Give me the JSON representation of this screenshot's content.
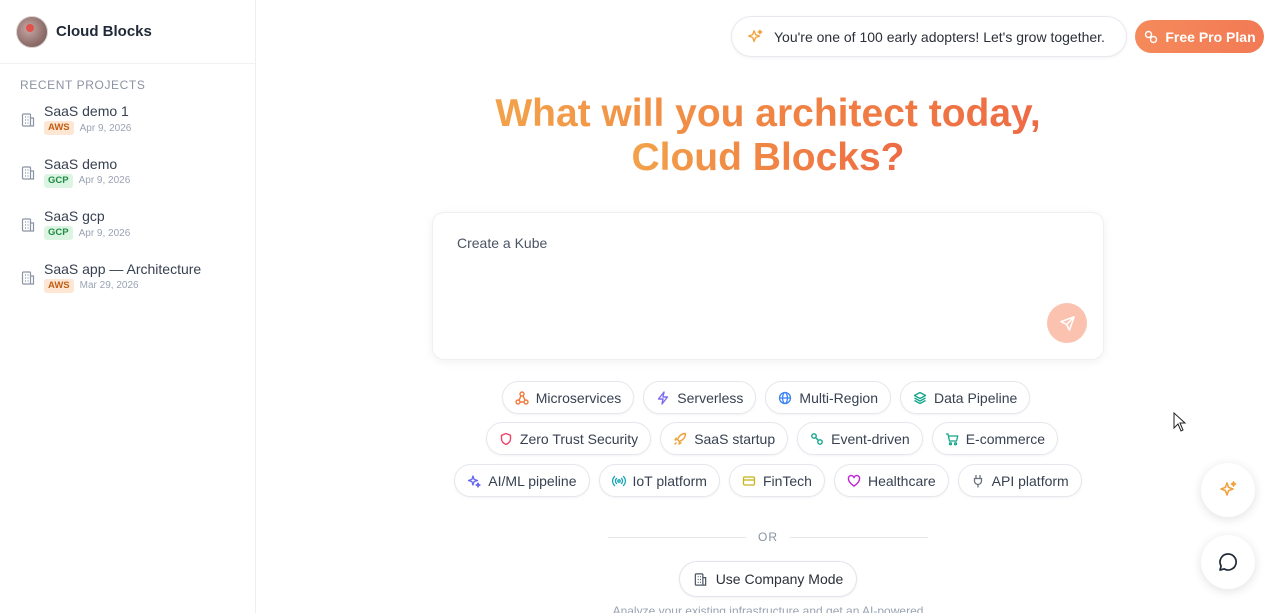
{
  "brand": {
    "name": "Cloud Blocks"
  },
  "sidebar": {
    "section_title": "RECENT PROJECTS",
    "projects": [
      {
        "name": "SaaS demo 1",
        "provider": "AWS",
        "date": "Apr 9, 2026"
      },
      {
        "name": "SaaS demo",
        "provider": "GCP",
        "date": "Apr 9, 2026"
      },
      {
        "name": "SaaS gcp",
        "provider": "GCP",
        "date": "Apr 9, 2026"
      },
      {
        "name": "SaaS app — Architecture",
        "provider": "AWS",
        "date": "Mar 29, 2026"
      }
    ]
  },
  "header": {
    "announcement": "You're one of 100 early adopters! Let's grow together.",
    "pro_button": "Free Pro Plan"
  },
  "hero": {
    "line1": "What will you architect today,",
    "line2": "Cloud Blocks?"
  },
  "prompt": {
    "value": "Create a Kube",
    "placeholder": ""
  },
  "chips": [
    {
      "label": "Microservices",
      "icon": "network-icon",
      "color": "#f07a3e"
    },
    {
      "label": "Serverless",
      "icon": "bolt-icon",
      "color": "#7c6cf0"
    },
    {
      "label": "Multi-Region",
      "icon": "globe-icon",
      "color": "#3b82f6"
    },
    {
      "label": "Data Pipeline",
      "icon": "layers-icon",
      "color": "#14a58a"
    },
    {
      "label": "Zero Trust Security",
      "icon": "shield-icon",
      "color": "#ef4466"
    },
    {
      "label": "SaaS startup",
      "icon": "rocket-icon",
      "color": "#f0a23b"
    },
    {
      "label": "Event-driven",
      "icon": "link-icon",
      "color": "#14a58a"
    },
    {
      "label": "E-commerce",
      "icon": "cart-icon",
      "color": "#14a58a"
    },
    {
      "label": "AI/ML pipeline",
      "icon": "sparkle-icon",
      "color": "#6366f1"
    },
    {
      "label": "IoT platform",
      "icon": "signal-icon",
      "color": "#14a5b8"
    },
    {
      "label": "FinTech",
      "icon": "card-icon",
      "color": "#c8b21e"
    },
    {
      "label": "Healthcare",
      "icon": "heart-icon",
      "color": "#c026d3"
    },
    {
      "label": "API platform",
      "icon": "plug-icon",
      "color": "#6b7280"
    }
  ],
  "divider": {
    "text": "OR"
  },
  "company_button": "Use Company Mode",
  "caption": "Analyze your existing infrastructure and get an AI-powered",
  "colors": {
    "accent": "#f27a55",
    "aws": "#c25d14",
    "gcp": "#218a46"
  }
}
